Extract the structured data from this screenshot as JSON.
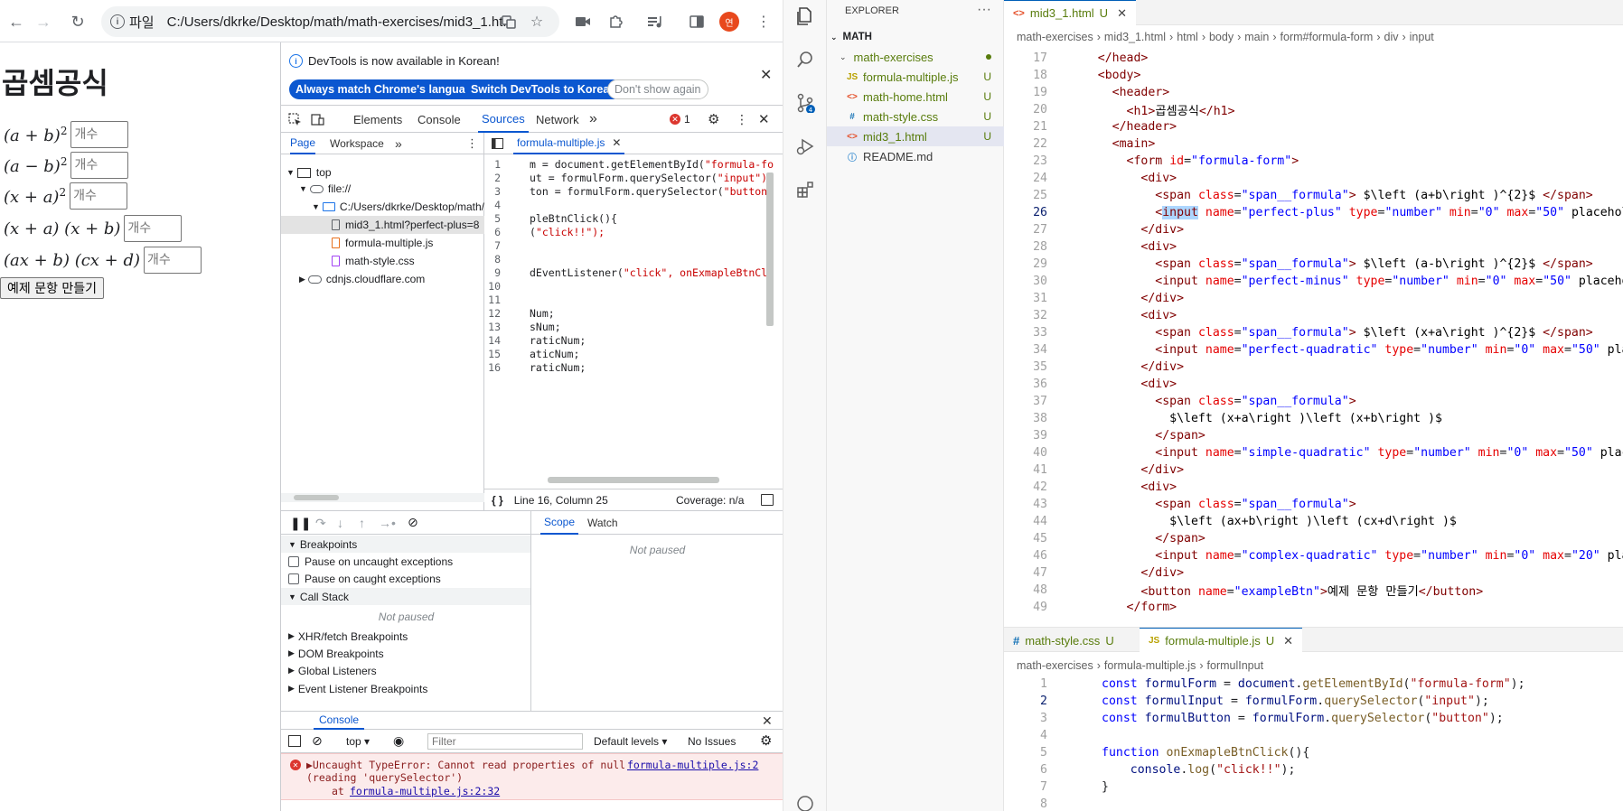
{
  "chrome": {
    "scheme_label": "파일",
    "url": "C:/Users/dkrke/Desktop/math/math-exercises/mid3_1.ht...",
    "profile_initial": "연"
  },
  "page": {
    "title": "곱셈공식",
    "formulas": [
      {
        "expr": "(a + b)",
        "sup": "2",
        "placeholder": "개수"
      },
      {
        "expr": "(a − b)",
        "sup": "2",
        "placeholder": "개수"
      },
      {
        "expr": "(x + a)",
        "sup": "2",
        "placeholder": "개수"
      },
      {
        "expr": "(x + a) (x + b)",
        "sup": "",
        "placeholder": "개수"
      },
      {
        "expr": "(ax + b) (cx + d)",
        "sup": "",
        "placeholder": "개수"
      }
    ],
    "button_label": "예제 문항 만들기"
  },
  "devtools": {
    "info_message": "DevTools is now available in Korean!",
    "btn_match": "Always match Chrome's language",
    "btn_switch": "Switch DevTools to Korean",
    "btn_dont_show": "Don't show again",
    "tabs": [
      "Elements",
      "Console",
      "Sources",
      "Network"
    ],
    "more": "»",
    "error_count": "1",
    "nav_tabs": [
      "Page",
      "Workspace"
    ],
    "tree": {
      "top": "top",
      "file": "file://",
      "folder": "C:/Users/dkrke/Desktop/math/",
      "files": [
        "mid3_1.html?perfect-plus=8",
        "formula-multiple.js",
        "math-style.css"
      ],
      "cdn": "cdnjs.cloudflare.com"
    },
    "open_file": "formula-multiple.js",
    "code_lines": [
      {
        "n": "1",
        "code": "m = document.getElementById(",
        "str": "\"formula-fo"
      },
      {
        "n": "2",
        "code": "ut = formulForm.querySelector(",
        "str": "\"input\");"
      },
      {
        "n": "3",
        "code": "ton = formulForm.querySelector(",
        "str": "\"button\""
      },
      {
        "n": "4",
        "code": "",
        "str": ""
      },
      {
        "n": "5",
        "code": "pleBtnClick(){",
        "str": ""
      },
      {
        "n": "6",
        "code": "(",
        "str": "\"click!!\");"
      },
      {
        "n": "7",
        "code": "",
        "str": ""
      },
      {
        "n": "8",
        "code": "",
        "str": ""
      },
      {
        "n": "9",
        "code": "dEventListener(",
        "str": "\"click\", onExmapleBtnCli"
      },
      {
        "n": "10",
        "code": "",
        "str": ""
      },
      {
        "n": "11",
        "code": "",
        "str": ""
      },
      {
        "n": "12",
        "code": "Num;",
        "str": ""
      },
      {
        "n": "13",
        "code": "sNum;",
        "str": ""
      },
      {
        "n": "14",
        "code": "raticNum;",
        "str": ""
      },
      {
        "n": "15",
        "code": "aticNum;",
        "str": ""
      },
      {
        "n": "16",
        "code": "raticNum;",
        "str": ""
      }
    ],
    "status_position": "Line 16, Column 25",
    "status_coverage": "Coverage: n/a",
    "scope_tab": "Scope",
    "watch_tab": "Watch",
    "not_paused": "Not paused",
    "breakpoints": "Breakpoints",
    "pause_uncaught": "Pause on uncaught exceptions",
    "pause_caught": "Pause on caught exceptions",
    "call_stack": "Call Stack",
    "call_not_paused": "Not paused",
    "xhr": "XHR/fetch Breakpoints",
    "dom": "DOM Breakpoints",
    "global": "Global Listeners",
    "event": "Event Listener Breakpoints",
    "console_tab": "Console",
    "console_context": "top",
    "filter_placeholder": "Filter",
    "default_levels": "Default levels",
    "no_issues": "No Issues",
    "error_line1": "▶Uncaught TypeError: Cannot read properties of null",
    "error_link1": "formula-multiple.js:2",
    "error_line2": "(reading 'querySelector')",
    "error_at": "at",
    "error_link2": "formula-multiple.js:2:32"
  },
  "vscode": {
    "explorer_title": "EXPLORER",
    "root": "MATH",
    "folder": "math-exercises",
    "files": [
      {
        "type": "JS",
        "name": "formula-multiple.js",
        "badge": "U",
        "color": "#b8a100"
      },
      {
        "type": "<>",
        "name": "math-home.html",
        "badge": "U",
        "color": "#e44d26"
      },
      {
        "type": "#",
        "name": "math-style.css",
        "badge": "U",
        "color": "#1572b6"
      },
      {
        "type": "<>",
        "name": "mid3_1.html",
        "badge": "U",
        "color": "#e44d26"
      },
      {
        "type": "ⓘ",
        "name": "README.md",
        "badge": "",
        "color": "#3d8fd1"
      }
    ],
    "tab_top": "mid3_1.html",
    "tab_top_badge": "U",
    "crumbs_top": [
      "math-exercises",
      "mid3_1.html",
      "html",
      "body",
      "main",
      "form#formula-form",
      "div",
      "input"
    ],
    "html_lines": [
      {
        "n": "17",
        "t": "    </head>"
      },
      {
        "n": "18",
        "t": "    <body>"
      },
      {
        "n": "19",
        "t": "      <header>"
      },
      {
        "n": "20",
        "t": "        <h1>곱셈공식</h1>"
      },
      {
        "n": "21",
        "t": "      </header>"
      },
      {
        "n": "22",
        "t": "      <main>"
      },
      {
        "n": "23",
        "t": "        <form id=\"formula-form\">"
      },
      {
        "n": "24",
        "t": "          <div>"
      },
      {
        "n": "25",
        "t": "            <span class=\"span__formula\"> $\\left (a+b\\right )^{2}$ </span>"
      },
      {
        "n": "26",
        "t": "            <input name=\"perfect-plus\" type=\"number\" min=\"0\" max=\"50\" placeholder="
      },
      {
        "n": "27",
        "t": "          </div>"
      },
      {
        "n": "28",
        "t": "          <div>"
      },
      {
        "n": "29",
        "t": "            <span class=\"span__formula\"> $\\left (a-b\\right )^{2}$ </span>"
      },
      {
        "n": "30",
        "t": "            <input name=\"perfect-minus\" type=\"number\" min=\"0\" max=\"50\" placeholder"
      },
      {
        "n": "31",
        "t": "          </div>"
      },
      {
        "n": "32",
        "t": "          <div>"
      },
      {
        "n": "33",
        "t": "            <span class=\"span__formula\"> $\\left (x+a\\right )^{2}$ </span>"
      },
      {
        "n": "34",
        "t": "            <input name=\"perfect-quadratic\" type=\"number\" min=\"0\" max=\"50\" placeho"
      },
      {
        "n": "35",
        "t": "          </div>"
      },
      {
        "n": "36",
        "t": "          <div>"
      },
      {
        "n": "37",
        "t": "            <span class=\"span__formula\">"
      },
      {
        "n": "38",
        "t": "              $\\left (x+a\\right )\\left (x+b\\right )$"
      },
      {
        "n": "39",
        "t": "            </span>"
      },
      {
        "n": "40",
        "t": "            <input name=\"simple-quadratic\" type=\"number\" min=\"0\" max=\"50\" placehol"
      },
      {
        "n": "41",
        "t": "          </div>"
      },
      {
        "n": "42",
        "t": "          <div>"
      },
      {
        "n": "43",
        "t": "            <span class=\"span__formula\">"
      },
      {
        "n": "44",
        "t": "              $\\left (ax+b\\right )\\left (cx+d\\right )$"
      },
      {
        "n": "45",
        "t": "            </span>"
      },
      {
        "n": "46",
        "t": "            <input name=\"complex-quadratic\" type=\"number\" min=\"0\" max=\"20\" placeho"
      },
      {
        "n": "47",
        "t": "          </div>"
      },
      {
        "n": "48",
        "t": "          <button name=\"exampleBtn\">예제 문항 만들기</button>"
      },
      {
        "n": "49",
        "t": "        </form>"
      }
    ],
    "tab_css": "math-style.css",
    "tab_css_badge": "U",
    "tab_js": "formula-multiple.js",
    "tab_js_badge": "U",
    "crumbs_bottom": [
      "math-exercises",
      "formula-multiple.js",
      "formulInput"
    ],
    "js_lines": [
      {
        "n": "1",
        "t": "const formulForm = document.getElementById(\"formula-form\");"
      },
      {
        "n": "2",
        "t": "const formulInput = formulForm.querySelector(\"input\");"
      },
      {
        "n": "3",
        "t": "const formulButton = formulForm.querySelector(\"button\");"
      },
      {
        "n": "4",
        "t": ""
      },
      {
        "n": "5",
        "t": "function onExmapleBtnClick(){"
      },
      {
        "n": "6",
        "t": "    console.log(\"click!!\");"
      },
      {
        "n": "7",
        "t": "}"
      },
      {
        "n": "8",
        "t": ""
      }
    ]
  }
}
